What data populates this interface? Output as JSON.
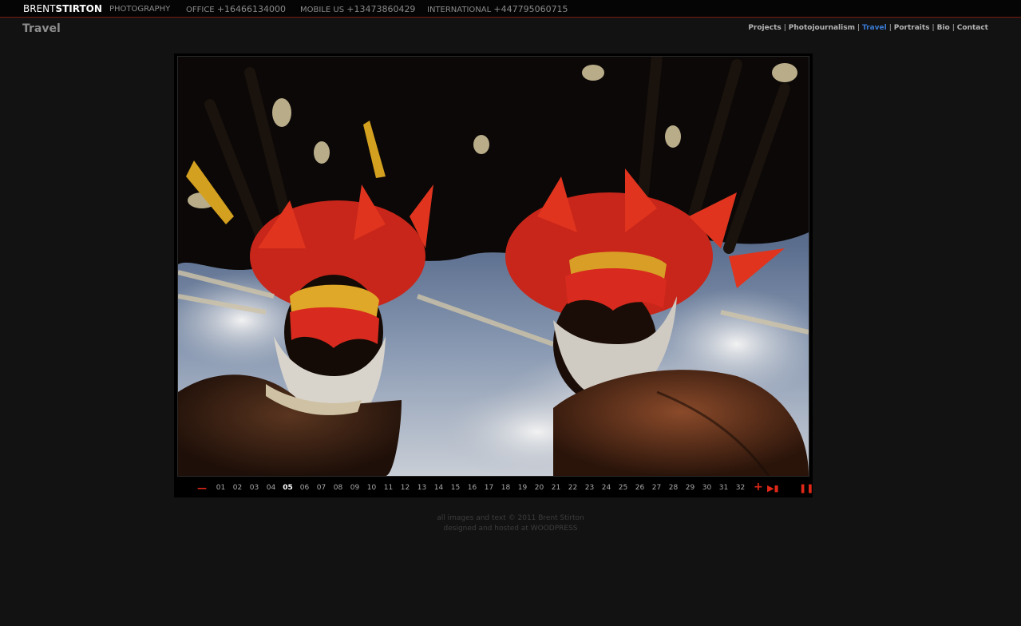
{
  "header": {
    "logo_light": "BRENT",
    "logo_bold": "STIRTON",
    "tagline": "PHOTOGRAPHY",
    "office_label": "OFFICE",
    "office_number": "+16466134000",
    "mobile_label": "MOBILE US",
    "mobile_number": "+13473860429",
    "intl_label": "INTERNATIONAL",
    "intl_number": "+447795060715"
  },
  "section_title": "Travel",
  "nav": {
    "items": [
      {
        "label": "Projects"
      },
      {
        "label": "Photojournalism"
      },
      {
        "label": "Travel",
        "active": true
      },
      {
        "label": "Portraits"
      },
      {
        "label": "Bio"
      },
      {
        "label": "Contact"
      }
    ],
    "separator": "|"
  },
  "colors": {
    "accent_red": "#e02818",
    "active_link": "#3a7bd5",
    "background": "#121212"
  },
  "gallery": {
    "current_page": "05",
    "pages": [
      "01",
      "02",
      "03",
      "04",
      "05",
      "06",
      "07",
      "08",
      "09",
      "10",
      "11",
      "12",
      "13",
      "14",
      "15",
      "16",
      "17",
      "18",
      "19",
      "20",
      "21",
      "22",
      "23",
      "24",
      "25",
      "26",
      "27",
      "28",
      "29",
      "30",
      "31",
      "32"
    ],
    "prev_icon": "minus-icon",
    "next_icon": "plus-icon",
    "last_icon": "skip-to-end-icon",
    "pause_icon": "pause-icon"
  },
  "footer": {
    "line1": "all images and text © 2011 Brent Stirton",
    "line2": "designed and hosted at WOODPRESS"
  }
}
